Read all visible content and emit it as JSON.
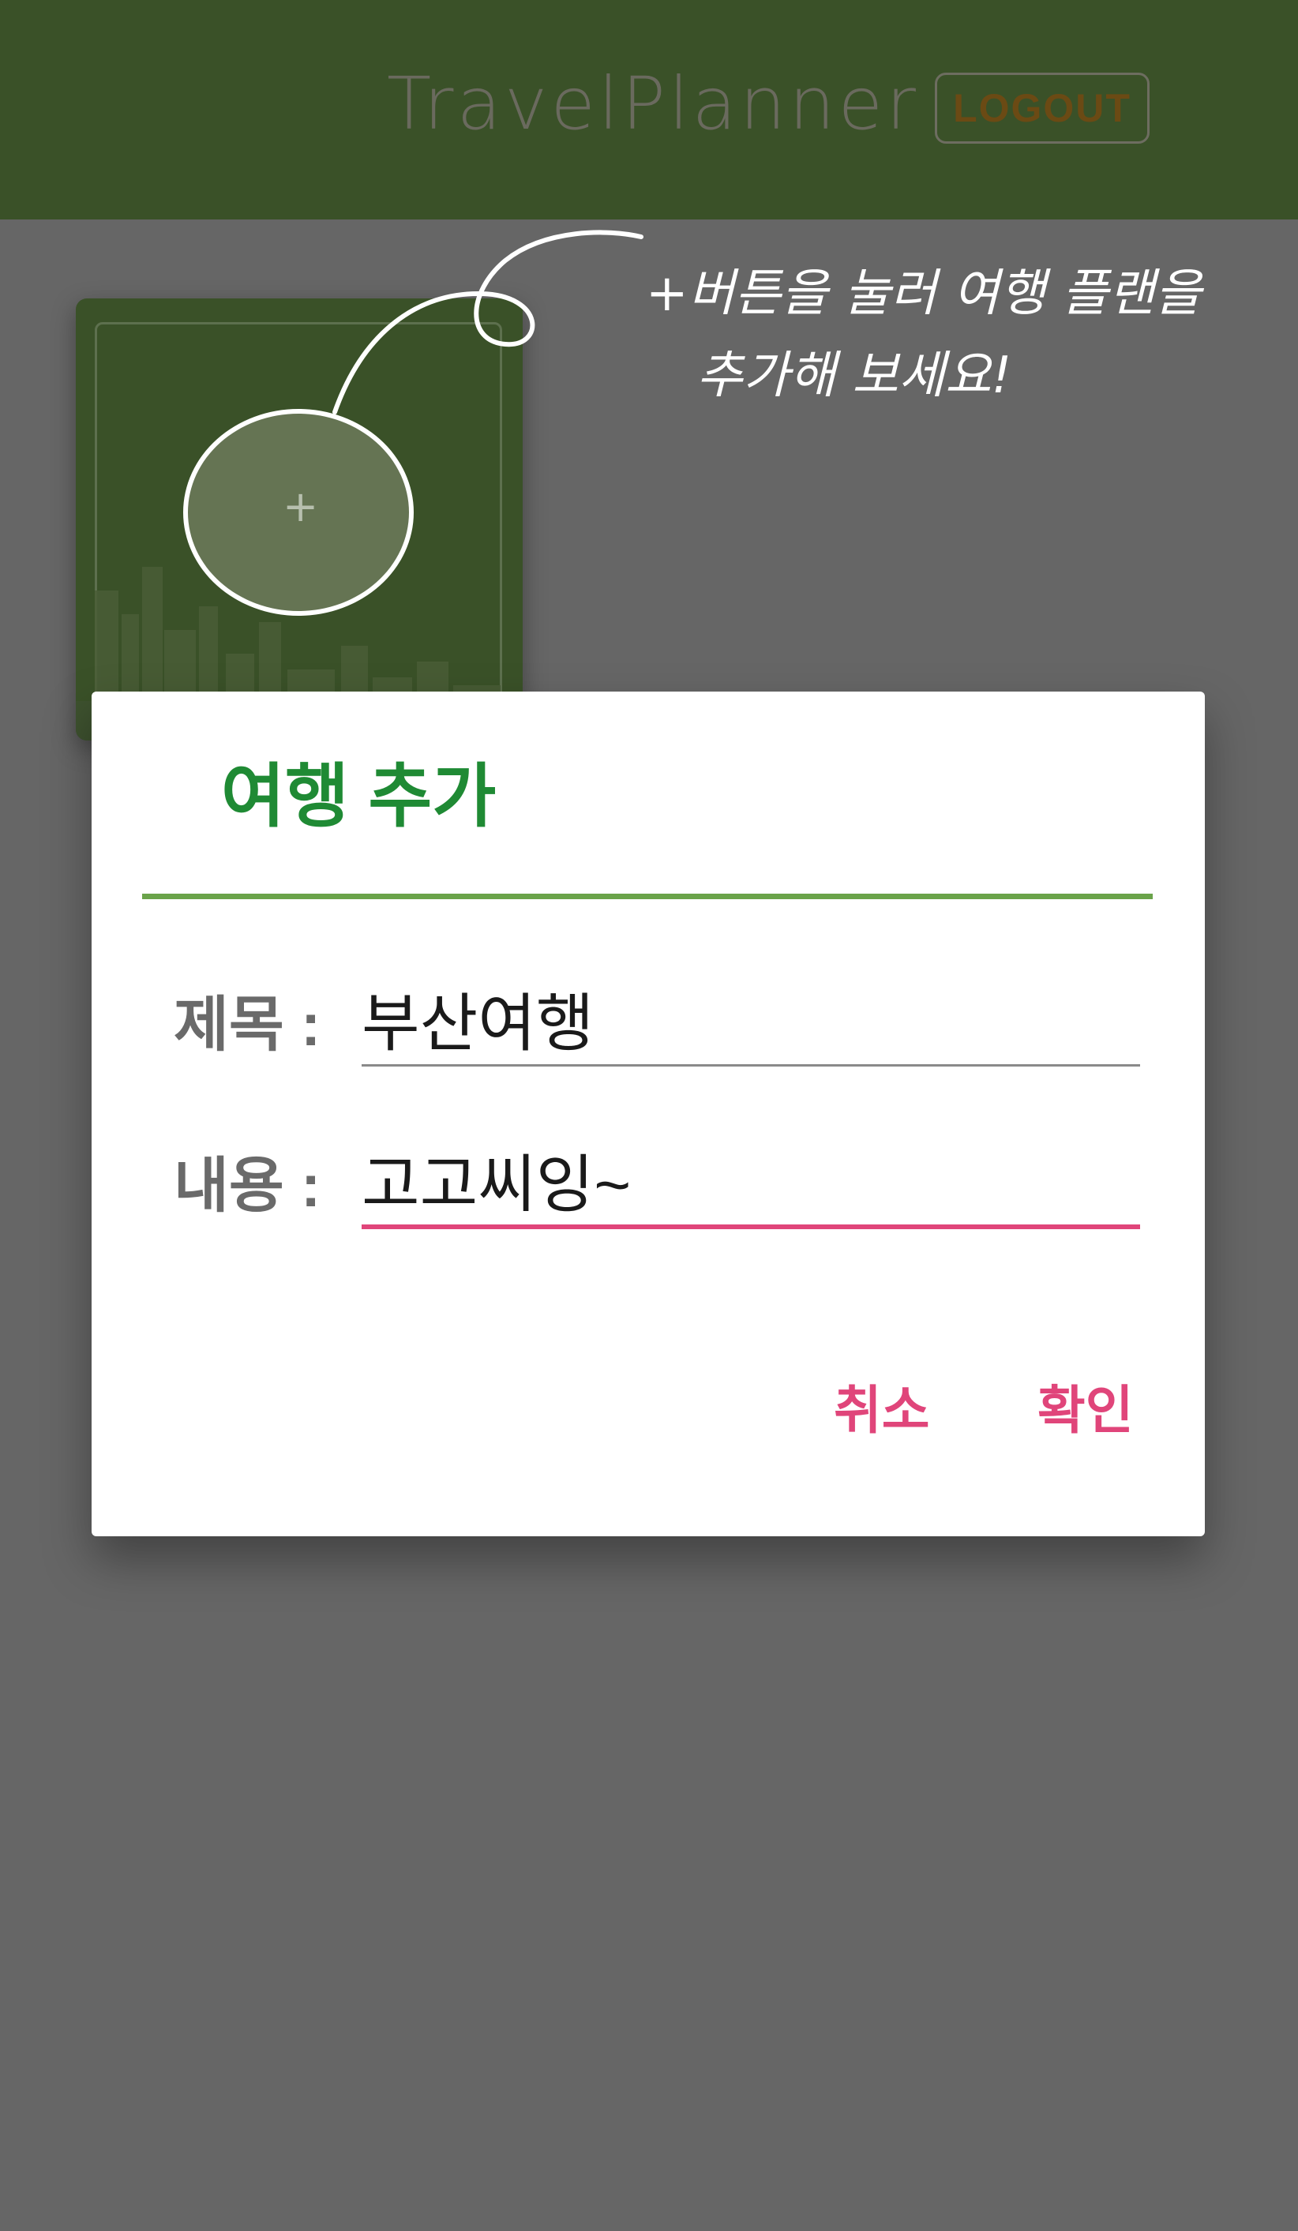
{
  "header": {
    "title": "TravelPlanner",
    "logout_label": "LOGOUT"
  },
  "card": {
    "add_icon": "plus-icon",
    "add_glyph": "+"
  },
  "hint": {
    "line1": "+버튼을 눌러 여행 플랜을",
    "line2": "추가해 보세요!"
  },
  "dialog": {
    "title": "여행 추가",
    "title_label": "제목 :",
    "title_value": "부산여행",
    "content_label": "내용 :",
    "content_value": "고고씨잉~",
    "cancel_label": "취소",
    "confirm_label": "확인"
  },
  "colors": {
    "header_bg": "#3a5128",
    "overlay": "#666666",
    "dialog_title": "#1f8a34",
    "divider": "#6aa34a",
    "accent_pink": "#e0457a"
  }
}
